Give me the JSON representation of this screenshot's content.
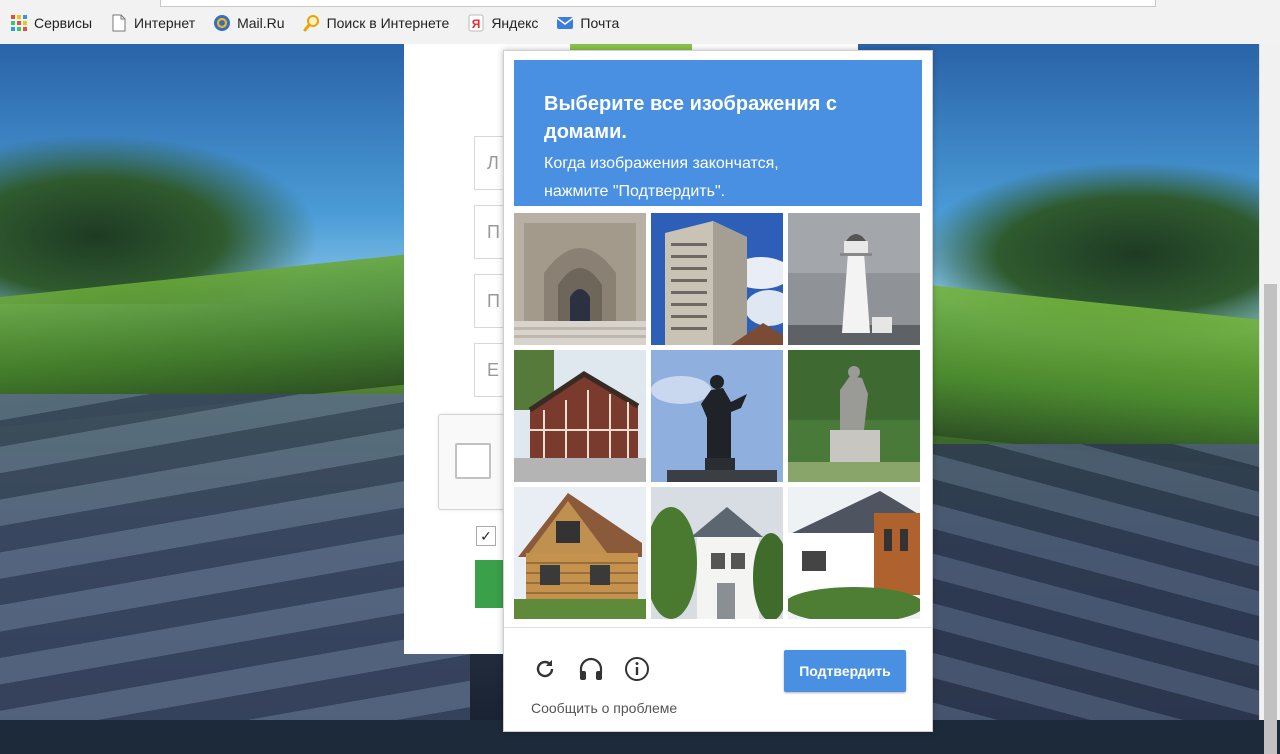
{
  "bookmarks": {
    "items": [
      {
        "label": "Сервисы",
        "icon": "apps-grid-icon"
      },
      {
        "label": "Интернет",
        "icon": "page-icon"
      },
      {
        "label": "Mail.Ru",
        "icon": "mailru-at-icon"
      },
      {
        "label": "Поиск в Интернете",
        "icon": "search-magnifier-icon"
      },
      {
        "label": "Яндекс",
        "icon": "yandex-icon"
      },
      {
        "label": "Почта",
        "icon": "mail-envelope-icon"
      }
    ]
  },
  "registration_form": {
    "inputs": [
      {
        "placeholder_prefix": "Л"
      },
      {
        "placeholder_prefix": "П"
      },
      {
        "placeholder_prefix": "П"
      },
      {
        "placeholder_prefix": "Е"
      }
    ],
    "agree_mark": "✓"
  },
  "challenge": {
    "title": "Выберите все изображения с домами.",
    "subtitle_line1": "Когда изображения закончатся,",
    "subtitle_line2": "нажмите \"Подтвердить\".",
    "tiles": [
      {
        "subject": "church portal arch"
      },
      {
        "subject": "tall apartment building"
      },
      {
        "subject": "lighthouse"
      },
      {
        "subject": "half-timbered house"
      },
      {
        "subject": "statue against sky"
      },
      {
        "subject": "statue on pedestal"
      },
      {
        "subject": "wooden house"
      },
      {
        "subject": "house among trees"
      },
      {
        "subject": "modern house"
      }
    ],
    "verify_label": "Подтвердить",
    "report_label": "Сообщить о проблеме",
    "colors": {
      "accent": "#4a90e2"
    }
  }
}
